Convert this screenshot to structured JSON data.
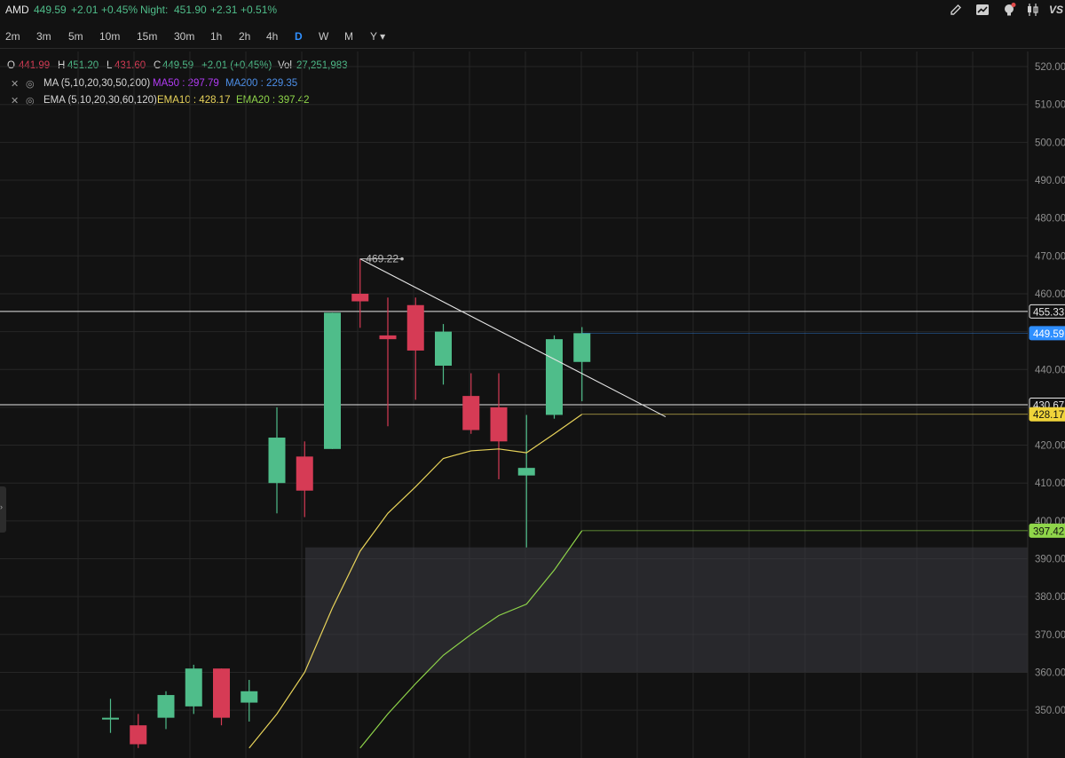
{
  "header": {
    "symbol": "AMD",
    "price": "449.59",
    "change": "+2.01",
    "change_pct": "+0.45%",
    "night_label": "Night:",
    "night_price": "451.90",
    "night_change": "+2.31",
    "night_change_pct": "+0.51%",
    "vs_label": "VS"
  },
  "toolbar_icons": [
    "pencil-icon",
    "chart-trend-icon",
    "lightbulb-icon",
    "candle-settings-icon"
  ],
  "timeframes": [
    "2m",
    "3m",
    "5m",
    "10m",
    "15m",
    "30m",
    "1h",
    "2h",
    "4h",
    "D",
    "W",
    "M",
    "Y ▾"
  ],
  "active_timeframe": "D",
  "ohlc": {
    "o_label": "O",
    "o": "441.99",
    "h_label": "H",
    "h": "451.20",
    "l_label": "L",
    "l": "431.60",
    "c_label": "C",
    "c": "449.59",
    "chg": "+2.01 (+0.45%)",
    "vol_label": "Vol",
    "vol": "27,251,983"
  },
  "ma": {
    "name": "MA (5,10,20,30,50,200)",
    "ma50": "MA50 : 297.79",
    "ma200": "MA200 : 229.35"
  },
  "ema": {
    "name": "EMA (5,10,20,30,60,120)",
    "ema10": "EMA10 : 428.17",
    "ema20": "EMA20 : 397.42"
  },
  "colors": {
    "up": "#4fbd8a",
    "down": "#d63b55",
    "ema10": "#e8d35a",
    "ema20": "#8fd54a",
    "ma50": "#b23bf5",
    "ma200": "#4d8fe8",
    "last_price_tag": "#2f8fff",
    "zone": "#3a3b42"
  },
  "chart_data": {
    "type": "candlestick",
    "y_ticks": [
      350,
      360,
      370,
      380,
      390,
      400,
      410,
      420,
      430,
      440,
      450,
      460,
      470,
      480,
      490,
      500,
      510,
      520
    ],
    "y_tick_labels": [
      "350.00",
      "360.00",
      "370.00",
      "380.00",
      "390.00",
      "400.00",
      "410.00",
      "420.00",
      "430.00",
      "440.00",
      "450.00",
      "460.00",
      "470.00",
      "480.00",
      "490.00",
      "500.00",
      "510.00",
      "520.00"
    ],
    "candles": [
      {
        "o": 348,
        "h": 353,
        "c": 348,
        "l": 344
      },
      {
        "o": 346,
        "h": 349,
        "c": 341,
        "l": 340
      },
      {
        "o": 348,
        "h": 355,
        "c": 354,
        "l": 345
      },
      {
        "o": 351,
        "h": 362,
        "c": 361,
        "l": 349
      },
      {
        "o": 361,
        "h": 361,
        "c": 348,
        "l": 346
      },
      {
        "o": 352,
        "h": 358,
        "c": 355,
        "l": 347
      },
      {
        "o": 410,
        "h": 430,
        "c": 422,
        "l": 402
      },
      {
        "o": 417,
        "h": 421,
        "c": 408,
        "l": 401
      },
      {
        "o": 419,
        "h": 455,
        "c": 455,
        "l": 419
      },
      {
        "o": 460,
        "h": 469.22,
        "c": 458,
        "l": 451
      },
      {
        "o": 449,
        "h": 459,
        "c": 448,
        "l": 425
      },
      {
        "o": 457,
        "h": 459,
        "c": 445,
        "l": 432
      },
      {
        "o": 441,
        "h": 452,
        "c": 450,
        "l": 436
      },
      {
        "o": 433,
        "h": 439,
        "c": 424,
        "l": 423
      },
      {
        "o": 430,
        "h": 439,
        "c": 421,
        "l": 411
      },
      {
        "o": 412,
        "h": 428,
        "c": 414,
        "l": 393
      },
      {
        "o": 428,
        "h": 449,
        "c": 448,
        "l": 427
      },
      {
        "o": 441.99,
        "h": 451.2,
        "c": 449.59,
        "l": 431.6
      }
    ],
    "ema10_series": [
      null,
      null,
      null,
      null,
      null,
      340,
      349,
      360,
      377,
      392,
      402,
      409,
      416.5,
      418.5,
      419,
      418,
      423,
      428.17
    ],
    "ema20_series": [
      null,
      null,
      null,
      null,
      null,
      null,
      null,
      null,
      null,
      340,
      349,
      357,
      364.5,
      370,
      375,
      378,
      387,
      397.42
    ],
    "swing_high_label": "469.22",
    "trendline": {
      "start": 469.22,
      "end": 427.5
    },
    "horizontal_lines": [
      455.33,
      430.67
    ],
    "price_tags": [
      {
        "value": 455.33,
        "label": "455.33",
        "style": "outline"
      },
      {
        "value": 449.59,
        "label": "449.59",
        "style": "blue"
      },
      {
        "value": 430.67,
        "label": "430.67",
        "style": "outline"
      },
      {
        "value": 428.17,
        "label": "428.17",
        "style": "yellow"
      },
      {
        "value": 397.42,
        "label": "397.42",
        "style": "green"
      }
    ],
    "zone": {
      "top": 393,
      "bottom": 360
    },
    "y_range": [
      344,
      524
    ]
  }
}
